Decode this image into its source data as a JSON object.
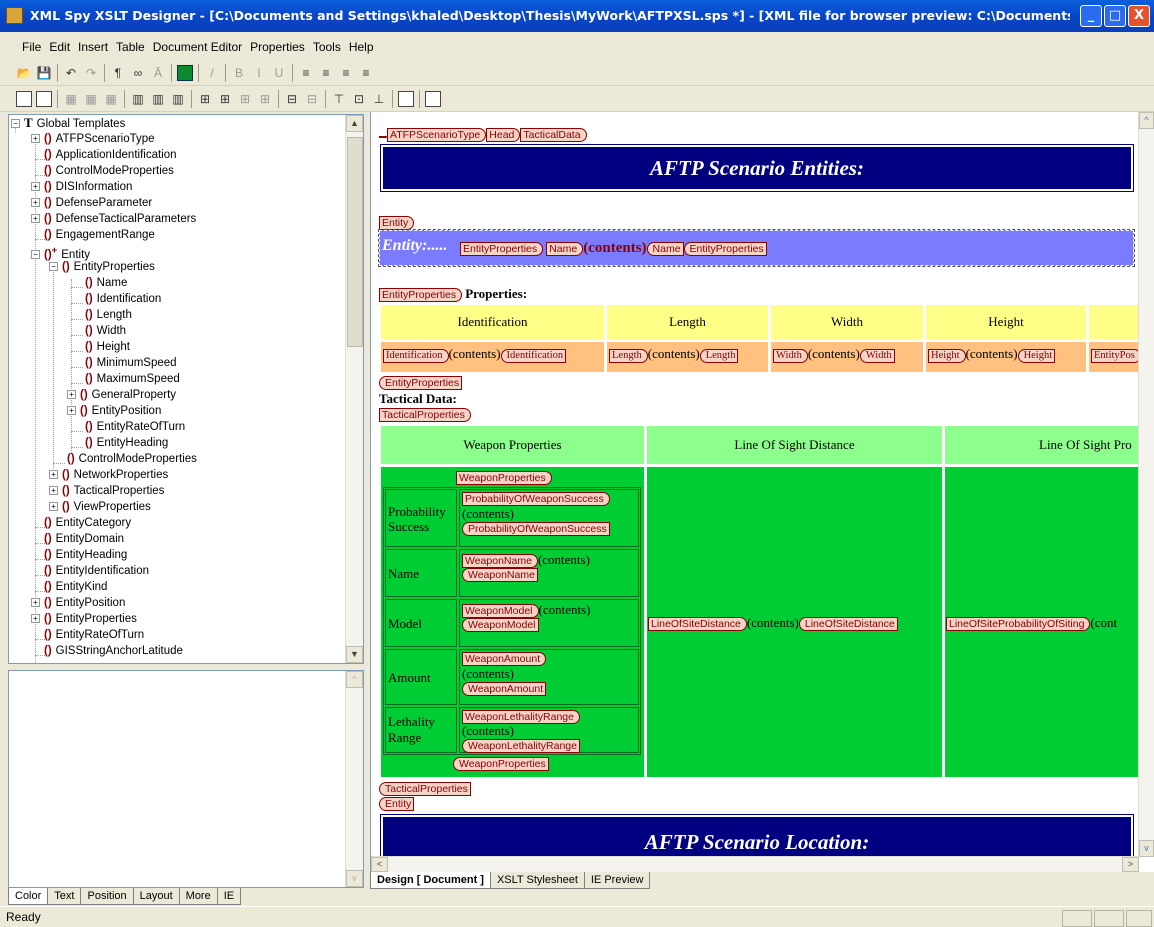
{
  "window": {
    "title": "XML Spy XSLT Designer - [C:\\Documents and Settings\\khaled\\Desktop\\Thesis\\MyWork\\AFTPXSL.sps *] - [XML file for browser preview: C:\\Documents an...",
    "min": "_",
    "max": "□",
    "close": "X"
  },
  "menu": [
    "File",
    "Edit",
    "Insert",
    "Table",
    "Document Editor",
    "Properties",
    "Tools",
    "Help"
  ],
  "tree": {
    "root": "Global Templates",
    "items": [
      "ATFPScenarioType",
      "ApplicationIdentification",
      "ControlModeProperties",
      "DISInformation",
      "DefenseParameter",
      "DefenseTacticalParameters",
      "EngagementRange",
      "Entity",
      "EntityProperties",
      "Name",
      "Identification",
      "Length",
      "Width",
      "Height",
      "MinimumSpeed",
      "MaximumSpeed",
      "GeneralProperty",
      "EntityPosition",
      "EntityRateOfTurn",
      "EntityHeading",
      "ControlModeProperties",
      "NetworkProperties",
      "TacticalProperties",
      "ViewProperties",
      "EntityCategory",
      "EntityDomain",
      "EntityHeading",
      "EntityIdentification",
      "EntityKind",
      "EntityPosition",
      "EntityProperties",
      "EntityRateOfTurn",
      "GISStringAnchorLatitude"
    ]
  },
  "prop_tabs": [
    "Color",
    "Text",
    "Position",
    "Layout",
    "More",
    "IE"
  ],
  "design": {
    "path_tags": [
      "ATFPScenarioType",
      "Head",
      "TacticalData"
    ],
    "banner1": "AFTP Scenario Entities:",
    "entity_tag": "Entity",
    "entity_label": "Entity:.....",
    "entity_props_tag": "EntityProperties",
    "name_tag": "Name",
    "contents": "(contents)",
    "properties_label": "Properties:",
    "prop_headers": [
      "Identification",
      "Length",
      "Width",
      "Height"
    ],
    "prop_tags": [
      "Identification",
      "Length",
      "Width",
      "Height",
      "EntityPos"
    ],
    "tactical_label": "Tactical Data:",
    "tactical_tag": "TacticalProperties",
    "green_headers": [
      "Weapon Properties",
      "Line Of Sight Distance",
      "Line Of Sight Pro"
    ],
    "weapon_tag": "WeaponProperties",
    "weapon_rows": [
      {
        "label": "Probability Success",
        "tag": "ProbabilityOfWeaponSuccess"
      },
      {
        "label": "Name",
        "tag": "WeaponName"
      },
      {
        "label": "Model",
        "tag": "WeaponModel"
      },
      {
        "label": "Amount",
        "tag": "WeaponAmount"
      },
      {
        "label": "Lethality Range",
        "tag": "WeaponLethalityRange"
      }
    ],
    "los_tag": "LineOfSiteDistance",
    "losp_tag": "LineOfSiteProbabilityOfSiting",
    "losp_contents": "(cont",
    "banner2": "AFTP Scenario Location:"
  },
  "doc_tabs": [
    "Design [ Document ]",
    "XSLT Stylesheet",
    "IE Preview"
  ],
  "status": "Ready"
}
